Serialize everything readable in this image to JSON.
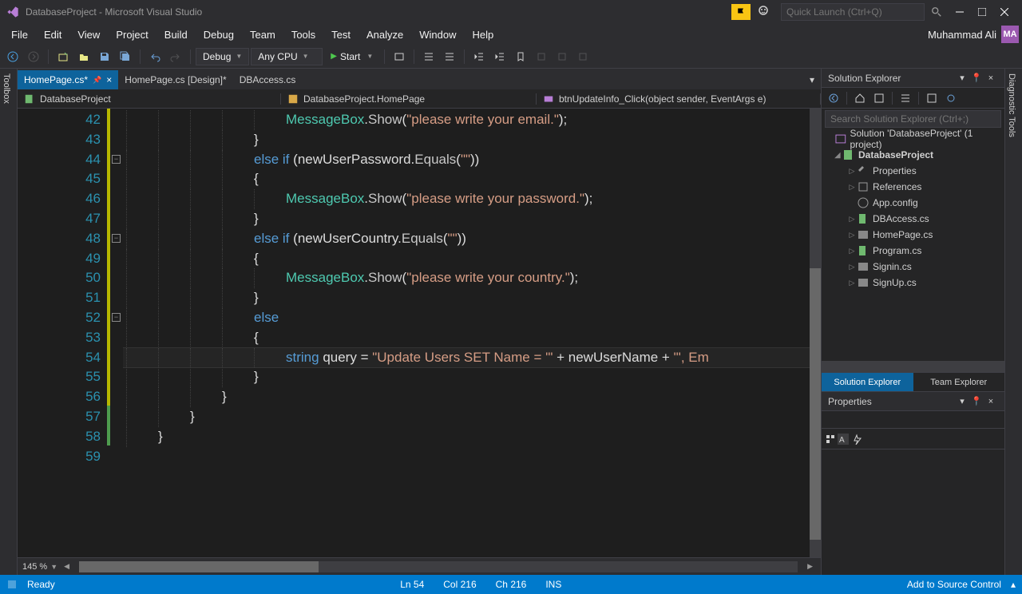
{
  "title": "DatabaseProject - Microsoft Visual Studio",
  "quick_launch_placeholder": "Quick Launch (Ctrl+Q)",
  "menu": [
    "File",
    "Edit",
    "View",
    "Project",
    "Build",
    "Debug",
    "Team",
    "Tools",
    "Test",
    "Analyze",
    "Window",
    "Help"
  ],
  "user_name": "Muhammad Ali",
  "user_initials": "MA",
  "toolbar": {
    "config": "Debug",
    "platform": "Any CPU",
    "start": "Start"
  },
  "left_tool": "Toolbox",
  "right_tool": "Diagnostic Tools",
  "tabs": [
    {
      "label": "HomePage.cs*",
      "active": true,
      "pinned": true
    },
    {
      "label": "HomePage.cs [Design]*",
      "active": false
    },
    {
      "label": "DBAccess.cs",
      "active": false
    }
  ],
  "context": {
    "left": "DatabaseProject",
    "mid": "DatabaseProject.HomePage",
    "right": "btnUpdateInfo_Click(object sender, EventArgs e)"
  },
  "code_lines": [
    {
      "n": 42,
      "indent": 5,
      "tokens": [
        {
          "t": "MessageBox",
          "c": "type"
        },
        {
          "t": ".",
          "c": "ident"
        },
        {
          "t": "Show",
          "c": "method"
        },
        {
          "t": "(",
          "c": "ident"
        },
        {
          "t": "\"please write your email.\"",
          "c": "str"
        },
        {
          "t": ");",
          "c": "ident"
        }
      ]
    },
    {
      "n": 43,
      "indent": 4,
      "tokens": [
        {
          "t": "}",
          "c": "ident"
        }
      ]
    },
    {
      "n": 44,
      "indent": 4,
      "fold": true,
      "tokens": [
        {
          "t": "else if",
          "c": "kw"
        },
        {
          "t": " (",
          "c": "ident"
        },
        {
          "t": "newUserPassword",
          "c": "ident"
        },
        {
          "t": ".",
          "c": "ident"
        },
        {
          "t": "Equals",
          "c": "method"
        },
        {
          "t": "(",
          "c": "ident"
        },
        {
          "t": "\"\"",
          "c": "str"
        },
        {
          "t": "))",
          "c": "ident"
        }
      ]
    },
    {
      "n": 45,
      "indent": 4,
      "tokens": [
        {
          "t": "{",
          "c": "ident"
        }
      ]
    },
    {
      "n": 46,
      "indent": 5,
      "tokens": [
        {
          "t": "MessageBox",
          "c": "type"
        },
        {
          "t": ".",
          "c": "ident"
        },
        {
          "t": "Show",
          "c": "method"
        },
        {
          "t": "(",
          "c": "ident"
        },
        {
          "t": "\"please write your password.\"",
          "c": "str"
        },
        {
          "t": ");",
          "c": "ident"
        }
      ]
    },
    {
      "n": 47,
      "indent": 4,
      "tokens": [
        {
          "t": "}",
          "c": "ident"
        }
      ]
    },
    {
      "n": 48,
      "indent": 4,
      "fold": true,
      "tokens": [
        {
          "t": "else if",
          "c": "kw"
        },
        {
          "t": " (",
          "c": "ident"
        },
        {
          "t": "newUserCountry",
          "c": "ident"
        },
        {
          "t": ".",
          "c": "ident"
        },
        {
          "t": "Equals",
          "c": "method"
        },
        {
          "t": "(",
          "c": "ident"
        },
        {
          "t": "\"\"",
          "c": "str"
        },
        {
          "t": "))",
          "c": "ident"
        }
      ]
    },
    {
      "n": 49,
      "indent": 4,
      "tokens": [
        {
          "t": "{",
          "c": "ident"
        }
      ]
    },
    {
      "n": 50,
      "indent": 5,
      "tokens": [
        {
          "t": "MessageBox",
          "c": "type"
        },
        {
          "t": ".",
          "c": "ident"
        },
        {
          "t": "Show",
          "c": "method"
        },
        {
          "t": "(",
          "c": "ident"
        },
        {
          "t": "\"please write your country.\"",
          "c": "str"
        },
        {
          "t": ");",
          "c": "ident"
        }
      ]
    },
    {
      "n": 51,
      "indent": 4,
      "tokens": [
        {
          "t": "}",
          "c": "ident"
        }
      ]
    },
    {
      "n": 52,
      "indent": 4,
      "fold": true,
      "tokens": [
        {
          "t": "else",
          "c": "kw"
        }
      ]
    },
    {
      "n": 53,
      "indent": 4,
      "tokens": [
        {
          "t": "{",
          "c": "ident"
        }
      ]
    },
    {
      "n": 54,
      "indent": 5,
      "current": true,
      "tokens": [
        {
          "t": "string",
          "c": "kw"
        },
        {
          "t": " ",
          "c": "ident"
        },
        {
          "t": "query",
          "c": "ident"
        },
        {
          "t": " = ",
          "c": "ident"
        },
        {
          "t": "\"Update Users SET Name = '\"",
          "c": "str"
        },
        {
          "t": " + ",
          "c": "ident"
        },
        {
          "t": "newUserName",
          "c": "ident"
        },
        {
          "t": " + ",
          "c": "ident"
        },
        {
          "t": "\"', Em",
          "c": "str"
        }
      ]
    },
    {
      "n": 55,
      "indent": 4,
      "tokens": [
        {
          "t": "}",
          "c": "ident"
        }
      ]
    },
    {
      "n": 56,
      "indent": 3,
      "tokens": [
        {
          "t": "}",
          "c": "ident"
        }
      ]
    },
    {
      "n": 57,
      "indent": 2,
      "tokens": [
        {
          "t": "}",
          "c": "ident"
        }
      ]
    },
    {
      "n": 58,
      "indent": 1,
      "tokens": [
        {
          "t": "}",
          "c": "ident"
        }
      ]
    },
    {
      "n": 59,
      "indent": 0,
      "tokens": []
    }
  ],
  "zoom": "145 %",
  "solution_explorer": {
    "title": "Solution Explorer",
    "search_placeholder": "Search Solution Explorer (Ctrl+;)",
    "root": "Solution 'DatabaseProject' (1 project)",
    "project": "DatabaseProject",
    "items": [
      "Properties",
      "References",
      "App.config",
      "DBAccess.cs",
      "HomePage.cs",
      "Program.cs",
      "Signin.cs",
      "SignUp.cs"
    ],
    "tabs": [
      "Solution Explorer",
      "Team Explorer"
    ]
  },
  "properties": {
    "title": "Properties"
  },
  "status": {
    "ready": "Ready",
    "ln": "Ln 54",
    "col": "Col 216",
    "ch": "Ch 216",
    "ins": "INS",
    "source_control": "Add to Source Control"
  }
}
